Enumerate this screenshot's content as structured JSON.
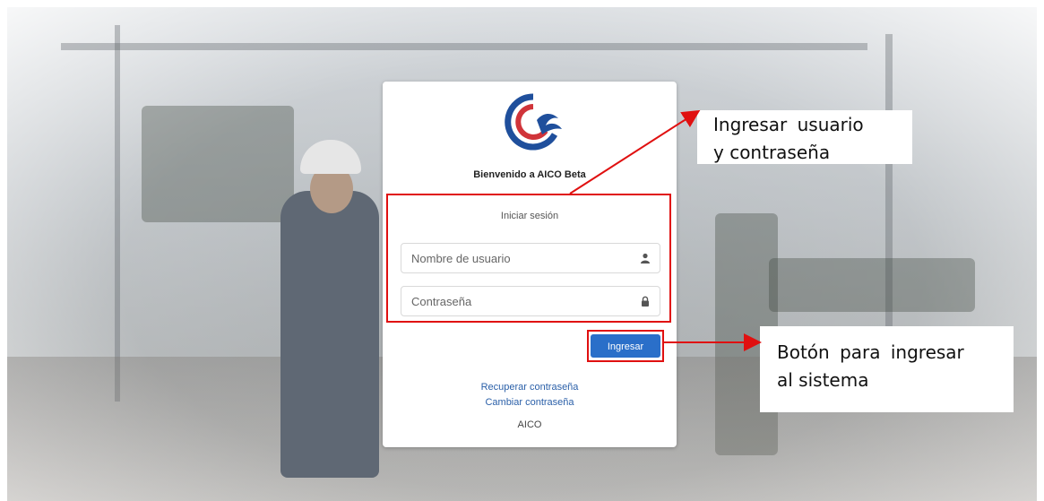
{
  "login": {
    "welcome": "Bienvenido a AICO Beta",
    "title": "Iniciar sesión",
    "username_placeholder": "Nombre de usuario",
    "password_placeholder": "Contraseña",
    "submit_label": "Ingresar",
    "recover_link": "Recuperar contraseña",
    "change_link": "Cambiar contraseña",
    "footer": "AICO"
  },
  "annotations": {
    "credentials_line1": "Ingresar usuario",
    "credentials_line2": "y contraseña",
    "button_line1": "Botón para ingresar",
    "button_line2": "al sistema"
  },
  "icons": {
    "username": "user-icon",
    "password": "lock-icon",
    "logo": "aico-logo"
  },
  "colors": {
    "primary_button": "#2a6fc9",
    "annotation_red": "#e01010",
    "logo_blue": "#1f4f9c",
    "logo_red": "#d0343a",
    "link": "#2a5fa8"
  }
}
